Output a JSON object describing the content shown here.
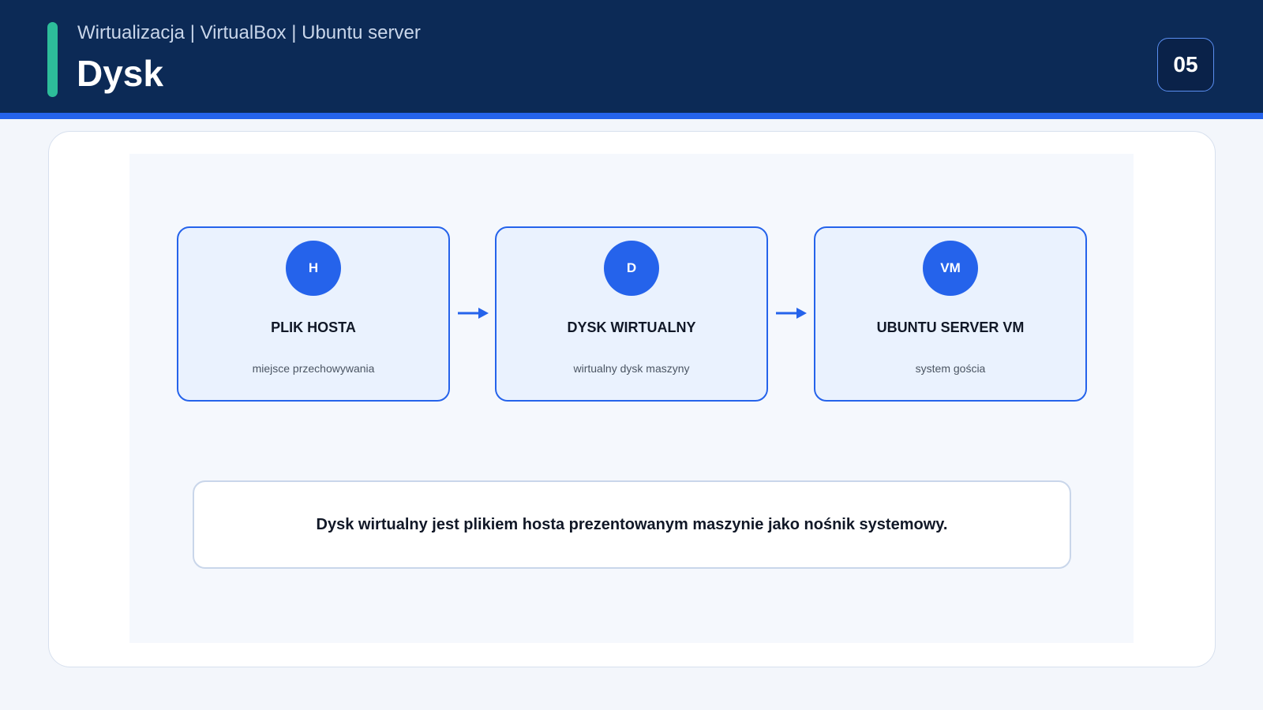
{
  "header": {
    "subtitle": "Wirtualizacja | VirtualBox | Ubuntu server",
    "title": "Dysk",
    "slide_number": "05"
  },
  "diagram": {
    "nodes": [
      {
        "badge": "H",
        "title": "PLIK HOSTA",
        "desc": "miejsce przechowywania"
      },
      {
        "badge": "D",
        "title": "DYSK WIRTUALNY",
        "desc": "wirtualny dysk maszyny"
      },
      {
        "badge": "VM",
        "title": "UBUNTU SERVER VM",
        "desc": "system gościa"
      }
    ],
    "caption": "Dysk wirtualny jest plikiem hosta prezentowanym maszynie jako nośnik systemowy."
  },
  "colors": {
    "header_bg": "#0c2a56",
    "accent": "#2dbd9a",
    "primary": "#2563eb",
    "node_bg": "#eaf2fe"
  }
}
